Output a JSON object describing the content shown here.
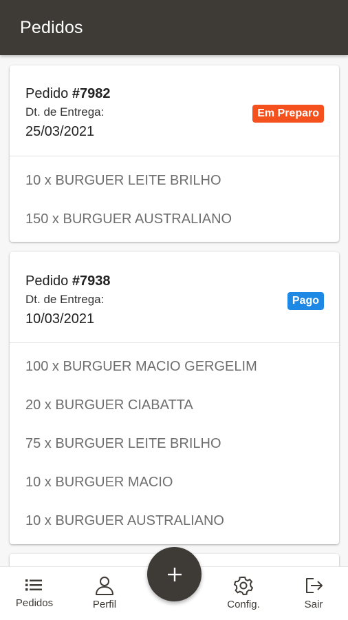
{
  "app_bar": {
    "title": "Pedidos",
    "background": "#3e3a36"
  },
  "orders": [
    {
      "prefix": "Pedido",
      "number": "#7982",
      "delivery_label": "Dt. de Entrega:",
      "delivery_date": "25/03/2021",
      "status": "Em Preparo",
      "status_color": "#f4511e",
      "items": [
        "10 x BURGUER LEITE BRILHO",
        "150 x BURGUER AUSTRALIANO"
      ]
    },
    {
      "prefix": "Pedido",
      "number": "#7938",
      "delivery_label": "Dt. de Entrega:",
      "delivery_date": "10/03/2021",
      "status": "Pago",
      "status_color": "#1e88e5",
      "items": [
        "100 x BURGUER MACIO GERGELIM",
        "20 x BURGUER CIABATTA",
        "75 x BURGUER LEITE BRILHO",
        "10 x BURGUER MACIO",
        "10 x BURGUER AUSTRALIANO"
      ]
    }
  ],
  "bottom_nav": {
    "items": [
      {
        "label": "Pedidos",
        "icon": "list-icon"
      },
      {
        "label": "Perfil",
        "icon": "person-icon"
      },
      {
        "label": "Config.",
        "icon": "gear-icon"
      },
      {
        "label": "Sair",
        "icon": "logout-icon"
      }
    ]
  },
  "fab": {
    "icon": "plus-icon"
  }
}
